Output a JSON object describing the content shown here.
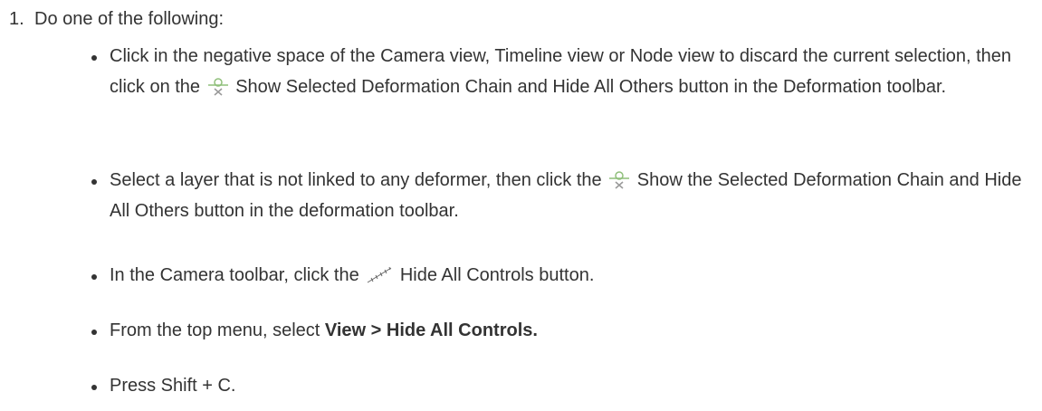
{
  "step": {
    "number": "1.",
    "intro": "Do one of the following:"
  },
  "bullets": [
    {
      "text_before": "Click in the negative space of the Camera view, Timeline view or Node view to discard the current selection, then click on the",
      "icon": "show-selected-deformation-chain-icon",
      "text_after": "Show Selected Deformation Chain and Hide All Others button in the Deformation toolbar."
    },
    {
      "text_before": "Select a layer that is not linked to any deformer, then click the",
      "icon": "show-selected-deformation-chain-icon",
      "text_after": "Show the Selected Deformation Chain and Hide All Others button in the deformation toolbar."
    },
    {
      "text_before": "In the Camera toolbar, click the",
      "icon": "hide-all-controls-icon",
      "text_after": "Hide All Controls button."
    },
    {
      "text_before": "From the top menu, select",
      "bold": "View > Hide All Controls."
    },
    {
      "text": "Press Shift + C."
    }
  ],
  "colors": {
    "text": "#333333",
    "icon_accent": "#8fbf7a",
    "icon_dark": "#666666"
  }
}
